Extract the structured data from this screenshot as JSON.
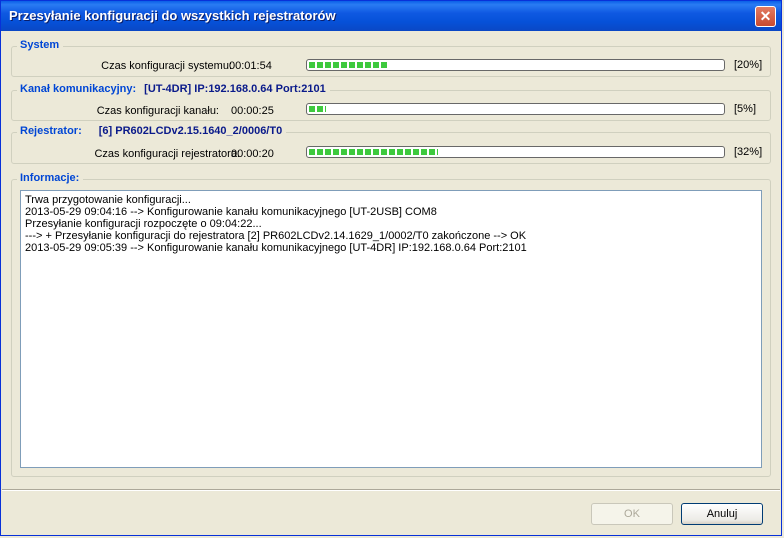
{
  "window": {
    "title": "Przesyłanie konfiguracji do wszystkich rejestratorów",
    "close_glyph": "✕"
  },
  "system": {
    "legend": "System",
    "label": "Czas konfiguracji systemu:",
    "time": "00:01:54",
    "percent_text": "[20%]",
    "progress": 0.2
  },
  "channel": {
    "legend": "Kanał komunikacyjny:",
    "detail": "[UT-4DR] IP:192.168.0.64  Port:2101",
    "label": "Czas konfiguracji kanału:",
    "time": "00:00:25",
    "percent_text": "[5%]",
    "progress": 0.05
  },
  "recorder": {
    "legend": "Rejestrator:",
    "detail": "[6] PR602LCDv2.15.1640_2/0006/T0",
    "label": "Czas konfiguracji rejestratora:",
    "time": "00:00:20",
    "percent_text": "[32%]",
    "progress": 0.32
  },
  "info": {
    "legend": "Informacje:",
    "lines": [
      "Trwa przygotowanie konfiguracji...",
      "2013-05-29 09:04:16 --> Konfigurowanie kanału komunikacyjnego [UT-2USB] COM8",
      "Przesyłanie konfiguracji rozpoczęte o 09:04:22...",
      "---> + Przesyłanie konfiguracji do rejestratora [2] PR602LCDv2.14.1629_1/0002/T0 zakończone --> OK",
      "2013-05-29 09:05:39 --> Konfigurowanie kanału komunikacyjnego [UT-4DR] IP:192.168.0.64  Port:2101"
    ]
  },
  "buttons": {
    "ok": "OK",
    "cancel": "Anuluj"
  }
}
